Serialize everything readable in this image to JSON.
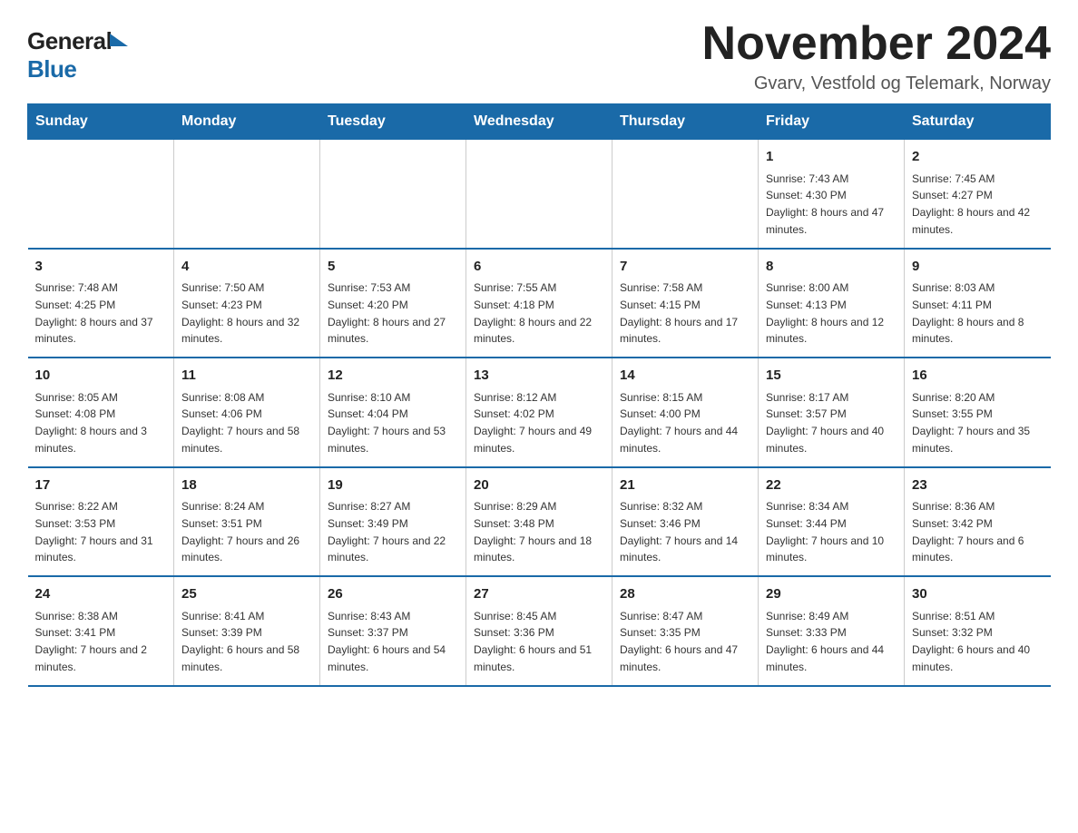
{
  "header": {
    "logo_general": "General",
    "logo_blue": "Blue",
    "month_title": "November 2024",
    "location": "Gvarv, Vestfold og Telemark, Norway"
  },
  "days_of_week": [
    "Sunday",
    "Monday",
    "Tuesday",
    "Wednesday",
    "Thursday",
    "Friday",
    "Saturday"
  ],
  "weeks": [
    [
      {
        "day": "",
        "info": ""
      },
      {
        "day": "",
        "info": ""
      },
      {
        "day": "",
        "info": ""
      },
      {
        "day": "",
        "info": ""
      },
      {
        "day": "",
        "info": ""
      },
      {
        "day": "1",
        "info": "Sunrise: 7:43 AM\nSunset: 4:30 PM\nDaylight: 8 hours and 47 minutes."
      },
      {
        "day": "2",
        "info": "Sunrise: 7:45 AM\nSunset: 4:27 PM\nDaylight: 8 hours and 42 minutes."
      }
    ],
    [
      {
        "day": "3",
        "info": "Sunrise: 7:48 AM\nSunset: 4:25 PM\nDaylight: 8 hours and 37 minutes."
      },
      {
        "day": "4",
        "info": "Sunrise: 7:50 AM\nSunset: 4:23 PM\nDaylight: 8 hours and 32 minutes."
      },
      {
        "day": "5",
        "info": "Sunrise: 7:53 AM\nSunset: 4:20 PM\nDaylight: 8 hours and 27 minutes."
      },
      {
        "day": "6",
        "info": "Sunrise: 7:55 AM\nSunset: 4:18 PM\nDaylight: 8 hours and 22 minutes."
      },
      {
        "day": "7",
        "info": "Sunrise: 7:58 AM\nSunset: 4:15 PM\nDaylight: 8 hours and 17 minutes."
      },
      {
        "day": "8",
        "info": "Sunrise: 8:00 AM\nSunset: 4:13 PM\nDaylight: 8 hours and 12 minutes."
      },
      {
        "day": "9",
        "info": "Sunrise: 8:03 AM\nSunset: 4:11 PM\nDaylight: 8 hours and 8 minutes."
      }
    ],
    [
      {
        "day": "10",
        "info": "Sunrise: 8:05 AM\nSunset: 4:08 PM\nDaylight: 8 hours and 3 minutes."
      },
      {
        "day": "11",
        "info": "Sunrise: 8:08 AM\nSunset: 4:06 PM\nDaylight: 7 hours and 58 minutes."
      },
      {
        "day": "12",
        "info": "Sunrise: 8:10 AM\nSunset: 4:04 PM\nDaylight: 7 hours and 53 minutes."
      },
      {
        "day": "13",
        "info": "Sunrise: 8:12 AM\nSunset: 4:02 PM\nDaylight: 7 hours and 49 minutes."
      },
      {
        "day": "14",
        "info": "Sunrise: 8:15 AM\nSunset: 4:00 PM\nDaylight: 7 hours and 44 minutes."
      },
      {
        "day": "15",
        "info": "Sunrise: 8:17 AM\nSunset: 3:57 PM\nDaylight: 7 hours and 40 minutes."
      },
      {
        "day": "16",
        "info": "Sunrise: 8:20 AM\nSunset: 3:55 PM\nDaylight: 7 hours and 35 minutes."
      }
    ],
    [
      {
        "day": "17",
        "info": "Sunrise: 8:22 AM\nSunset: 3:53 PM\nDaylight: 7 hours and 31 minutes."
      },
      {
        "day": "18",
        "info": "Sunrise: 8:24 AM\nSunset: 3:51 PM\nDaylight: 7 hours and 26 minutes."
      },
      {
        "day": "19",
        "info": "Sunrise: 8:27 AM\nSunset: 3:49 PM\nDaylight: 7 hours and 22 minutes."
      },
      {
        "day": "20",
        "info": "Sunrise: 8:29 AM\nSunset: 3:48 PM\nDaylight: 7 hours and 18 minutes."
      },
      {
        "day": "21",
        "info": "Sunrise: 8:32 AM\nSunset: 3:46 PM\nDaylight: 7 hours and 14 minutes."
      },
      {
        "day": "22",
        "info": "Sunrise: 8:34 AM\nSunset: 3:44 PM\nDaylight: 7 hours and 10 minutes."
      },
      {
        "day": "23",
        "info": "Sunrise: 8:36 AM\nSunset: 3:42 PM\nDaylight: 7 hours and 6 minutes."
      }
    ],
    [
      {
        "day": "24",
        "info": "Sunrise: 8:38 AM\nSunset: 3:41 PM\nDaylight: 7 hours and 2 minutes."
      },
      {
        "day": "25",
        "info": "Sunrise: 8:41 AM\nSunset: 3:39 PM\nDaylight: 6 hours and 58 minutes."
      },
      {
        "day": "26",
        "info": "Sunrise: 8:43 AM\nSunset: 3:37 PM\nDaylight: 6 hours and 54 minutes."
      },
      {
        "day": "27",
        "info": "Sunrise: 8:45 AM\nSunset: 3:36 PM\nDaylight: 6 hours and 51 minutes."
      },
      {
        "day": "28",
        "info": "Sunrise: 8:47 AM\nSunset: 3:35 PM\nDaylight: 6 hours and 47 minutes."
      },
      {
        "day": "29",
        "info": "Sunrise: 8:49 AM\nSunset: 3:33 PM\nDaylight: 6 hours and 44 minutes."
      },
      {
        "day": "30",
        "info": "Sunrise: 8:51 AM\nSunset: 3:32 PM\nDaylight: 6 hours and 40 minutes."
      }
    ]
  ]
}
